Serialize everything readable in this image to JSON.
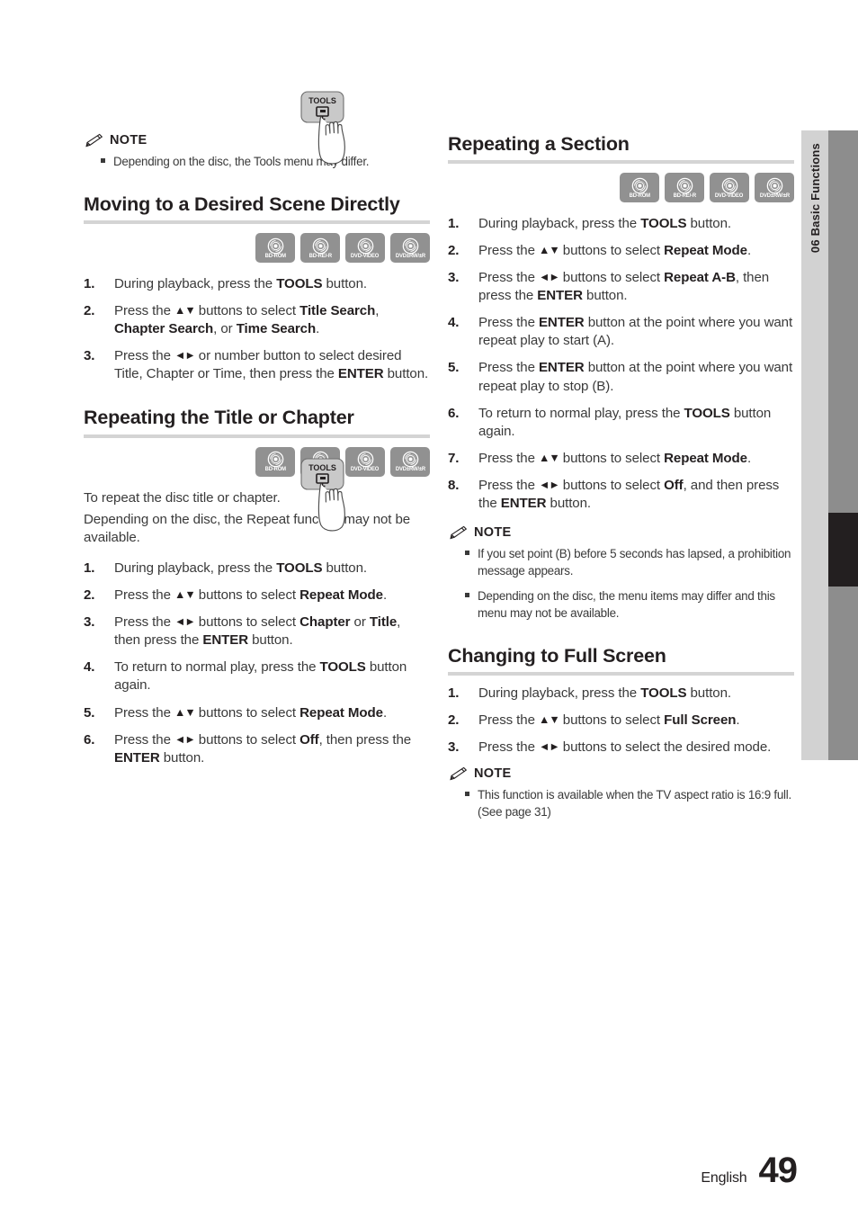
{
  "page": {
    "footer_language": "English",
    "footer_page_number": "49",
    "chapter_number": "06",
    "chapter_title": "Basic Functions",
    "side_tab_label": "06   Basic Functions"
  },
  "colors": {
    "text": "#231f20",
    "body_text": "#3a3a3a",
    "heading_rule": "#d4d4d4",
    "disc_badge": "#919191",
    "side_tab": "#d2d2d2",
    "side_bar_track": "#8d8d8d",
    "side_bar_marker": "#231f20"
  },
  "disc_badges": [
    {
      "icon": "disc-icon",
      "label": "BD-ROM"
    },
    {
      "icon": "disc-icon",
      "label": "BD-RE/-R"
    },
    {
      "icon": "disc-icon",
      "label": "DVD-VIDEO"
    },
    {
      "icon": "disc-icon",
      "label": "DVD±RW/±R"
    }
  ],
  "note_label": "NOTE",
  "tools_button_label": "TOOLS",
  "left_column": {
    "note_top": {
      "title": "NOTE",
      "items": [
        "Depending on the disc, the Tools menu may differ."
      ]
    },
    "section_moving": {
      "heading": "Moving to a Desired Scene Directly",
      "steps": [
        {
          "num": "1.",
          "html": "During playback, press the <b>TOOLS</b> button."
        },
        {
          "num": "2.",
          "html": "Press the <span class=\"arrows\">▲▼</span> buttons to select <b>Title Search</b>, <b>Chapter Search</b>, or <b>Time Search</b>."
        },
        {
          "num": "3.",
          "html": "Press the <span class=\"arrows\">◄►</span> or number button to select desired Title, Chapter or Time, then press the <b>ENTER</b> button."
        }
      ]
    },
    "section_repeating_title": {
      "heading": "Repeating the Title or Chapter",
      "intro_line_1": "To repeat the disc title or chapter.",
      "intro_line_2": "Depending on the disc, the Repeat function may not be available.",
      "steps": [
        {
          "num": "1.",
          "html": "During playback, press the <b>TOOLS</b> button."
        },
        {
          "num": "2.",
          "html": "Press the <span class=\"arrows\">▲▼</span> buttons to select <b>Repeat Mode</b>."
        },
        {
          "num": "3.",
          "html": "Press the <span class=\"arrows\">◄►</span> buttons to select <b>Chapter</b> or <b>Title</b>, then press the <b>ENTER</b> button."
        },
        {
          "num": "4.",
          "html": "To return to normal play, press the <b>TOOLS</b> button again."
        },
        {
          "num": "5.",
          "html": "Press the <span class=\"arrows\">▲▼</span> buttons to select <b>Repeat Mode</b>."
        },
        {
          "num": "6.",
          "html": "Press the <span class=\"arrows\">◄►</span> buttons to select <b>Off</b>, then press the <b>ENTER</b> button."
        }
      ]
    }
  },
  "right_column": {
    "section_repeating_section": {
      "heading": "Repeating a Section",
      "steps": [
        {
          "num": "1.",
          "html": "During playback, press the <b>TOOLS</b> button."
        },
        {
          "num": "2.",
          "html": "Press the <span class=\"arrows\">▲▼</span> buttons to select <b>Repeat Mode</b>."
        },
        {
          "num": "3.",
          "html": "Press the <span class=\"arrows\">◄►</span> buttons to select <b>Repeat A-B</b>, then press the <b>ENTER</b> button."
        },
        {
          "num": "4.",
          "html": "Press the <b>ENTER</b> button at the point where you want repeat play to start (A)."
        },
        {
          "num": "5.",
          "html": "Press the <b>ENTER</b> button at the point where you want repeat play to stop (B)."
        },
        {
          "num": "6.",
          "html": "To return to normal play, press the <b>TOOLS</b> button again."
        },
        {
          "num": "7.",
          "html": "Press the <span class=\"arrows\">▲▼</span> buttons to select <b>Repeat Mode</b>."
        },
        {
          "num": "8.",
          "html": "Press the <span class=\"arrows\">◄►</span> buttons to select <b>Off</b>, and then press the <b>ENTER</b> button."
        }
      ],
      "note": {
        "title": "NOTE",
        "items": [
          "If you set point (B) before 5 seconds has lapsed, a prohibition message appears.",
          "Depending on the disc, the menu items may differ and this menu may not be available."
        ]
      }
    },
    "section_full_screen": {
      "heading": "Changing to Full Screen",
      "steps": [
        {
          "num": "1.",
          "html": "During playback, press the <b>TOOLS</b> button."
        },
        {
          "num": "2.",
          "html": "Press the <span class=\"arrows\">▲▼</span> buttons to select <b>Full Screen</b>."
        },
        {
          "num": "3.",
          "html": "Press the <span class=\"arrows\">◄►</span> buttons to select the desired mode."
        }
      ],
      "note": {
        "title": "NOTE",
        "items": [
          "This function is available when the TV aspect ratio is 16:9 full. (See page 31)"
        ]
      }
    }
  }
}
